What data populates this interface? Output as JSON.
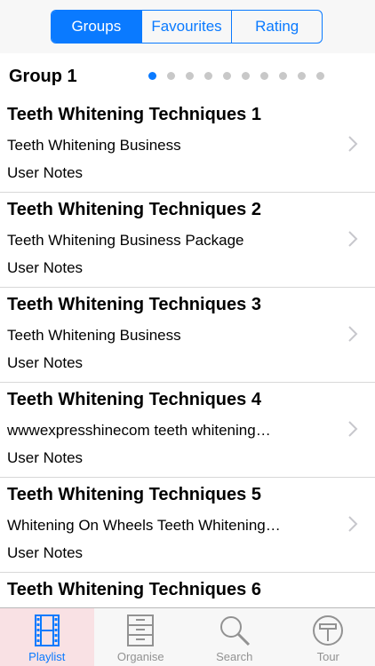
{
  "segments": [
    "Groups",
    "Favourites",
    "Rating"
  ],
  "group": {
    "title": "Group 1",
    "page_count": 10,
    "current_page": 1
  },
  "items": [
    {
      "title": "Teeth Whitening Techniques 1",
      "subtitle": "Teeth Whitening Business",
      "notes": "User Notes"
    },
    {
      "title": "Teeth Whitening Techniques 2",
      "subtitle": "Teeth Whitening Business Package",
      "notes": "User Notes"
    },
    {
      "title": "Teeth Whitening Techniques 3",
      "subtitle": "Teeth Whitening Business",
      "notes": "User Notes"
    },
    {
      "title": "Teeth Whitening Techniques 4",
      "subtitle": "wwwexpresshinecom teeth whitening…",
      "notes": "User Notes"
    },
    {
      "title": "Teeth Whitening Techniques 5",
      "subtitle": "Whitening On Wheels Teeth Whitening…",
      "notes": "User Notes"
    },
    {
      "title": "Teeth Whitening Techniques 6",
      "subtitle": "",
      "notes": ""
    }
  ],
  "tabs": [
    {
      "label": "Playlist",
      "icon": "film-strip-icon"
    },
    {
      "label": "Organise",
      "icon": "filing-cabinet-icon"
    },
    {
      "label": "Search",
      "icon": "magnifier-icon"
    },
    {
      "label": "Tour",
      "icon": "tour-sign-icon"
    }
  ],
  "colors": {
    "accent": "#0a7aff",
    "active_tab_bg": "#f9e1e4",
    "inactive": "#929292"
  }
}
